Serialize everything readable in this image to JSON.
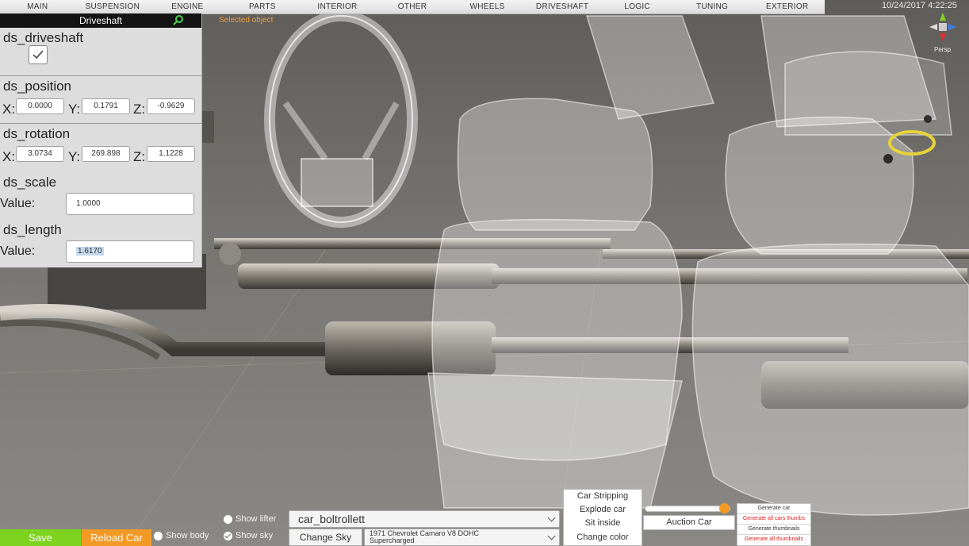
{
  "top_menu": {
    "items": [
      "MAIN",
      "SUSPENSION",
      "ENGINE",
      "PARTS",
      "INTERIOR",
      "OTHER",
      "WHEELS",
      "DRIVESHAFT",
      "LOGIC",
      "TUNING",
      "EXTERIOR"
    ]
  },
  "datetime": "10/24/2017 4:22:25",
  "gizmo": {
    "label": "Persp"
  },
  "viewport": {
    "selected_label": "Selected object"
  },
  "inspector": {
    "title": "Driveshaft",
    "driveshaft": {
      "label": "ds_driveshaft",
      "checked": true
    },
    "position": {
      "label": "ds_position",
      "x_label": "X:",
      "y_label": "Y:",
      "z_label": "Z:",
      "x": "0.0000",
      "y": "0.1791",
      "z": "-0.9629"
    },
    "rotation": {
      "label": "ds_rotation",
      "x_label": "X:",
      "y_label": "Y:",
      "z_label": "Z:",
      "x": "3.0734",
      "y": "269.898",
      "z": "1.1228"
    },
    "scale": {
      "label": "ds_scale",
      "value_label": "Value:",
      "value": "1.0000"
    },
    "length": {
      "label": "ds_length",
      "value_label": "Value:",
      "value": "1.6170"
    }
  },
  "bottom": {
    "save_label": "Save",
    "reload_label": "Reload Car",
    "show_body_label": "Show body",
    "show_lifter_label": "Show lifter",
    "show_sky_label": "Show sky",
    "car_select": "car_boltrollett",
    "change_sky_label": "Change Sky",
    "model_select_line1": "1971 Chevrolet Camaro V8 DOHC",
    "model_select_line2": "Supercharged",
    "actions": [
      "Car Stripping",
      "Explode car",
      "Sit inside",
      "Change color"
    ],
    "auction_label": "Auction Car",
    "generate": [
      "Generate car",
      "Generate all cars thumbs",
      "Generate thumbnails",
      "Generate all thumbnails"
    ]
  },
  "colors": {
    "save": "#7ed321",
    "reload": "#f39a26",
    "accent_orange": "#f39a26",
    "gen_red": "#e02020"
  }
}
